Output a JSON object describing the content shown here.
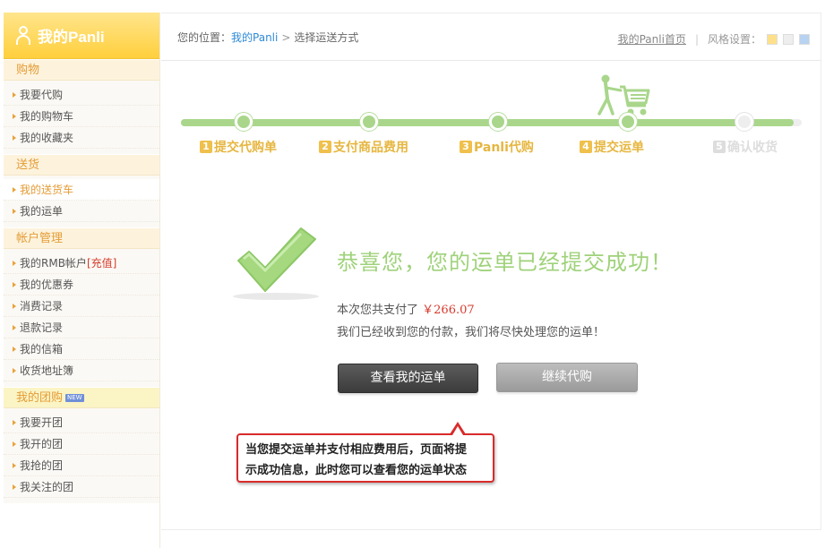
{
  "sidebar": {
    "brand": "我的Panli",
    "sections": [
      {
        "title": "购物",
        "items": [
          {
            "label": "我要代购"
          },
          {
            "label": "我的购物车"
          },
          {
            "label": "我的收藏夹"
          }
        ]
      },
      {
        "title": "送货",
        "items": [
          {
            "label": "我的送货车"
          },
          {
            "label": "我的运单"
          }
        ]
      },
      {
        "title": "帐户管理",
        "items": [
          {
            "label": "我的RMB帐户",
            "tag": "[充值]"
          },
          {
            "label": "我的优惠券"
          },
          {
            "label": "消费记录"
          },
          {
            "label": "退款记录"
          },
          {
            "label": "我的信箱"
          },
          {
            "label": "收货地址簿"
          }
        ]
      },
      {
        "title": "我的团购",
        "badge": "NEW",
        "items": [
          {
            "label": "我要开团"
          },
          {
            "label": "我开的团"
          },
          {
            "label": "我抢的团"
          },
          {
            "label": "我关注的团"
          }
        ]
      }
    ],
    "active_item": "我的送货车"
  },
  "header": {
    "breadcrumb_prefix": "您的位置：",
    "breadcrumb_link": "我的Panli",
    "breadcrumb_sep": ">",
    "breadcrumb_current": "选择运送方式",
    "home_link": "我的Panli首页",
    "divider": "|",
    "style_label": "风格设置：",
    "style_swatches": [
      "#ffe08a",
      "#eeeeee",
      "#b8d2f2"
    ]
  },
  "progress": {
    "steps": [
      {
        "num": "1",
        "label": "提交代购单",
        "done": true
      },
      {
        "num": "2",
        "label": "支付商品费用",
        "done": true
      },
      {
        "num": "3",
        "label": "Panli代购",
        "done": true
      },
      {
        "num": "4",
        "label": "提交运单",
        "done": true
      },
      {
        "num": "5",
        "label": "确认收货",
        "done": false
      }
    ],
    "current_step": 4,
    "accent_color": "#a9d68b"
  },
  "result": {
    "title": "恭喜您，您的运单已经提交成功！",
    "paid_text": "本次您共支付了",
    "amount": "￥266.07",
    "received_text": "我们已经收到您的付款，我们将尽快处理您的运单！"
  },
  "buttons": {
    "view_waybill": "查看我的运单",
    "continue_shopping": "继续代购"
  },
  "callout": {
    "line1": "当您提交运单并支付相应费用后，页面将提",
    "line2": "示成功信息，此时您可以查看您的运单状态"
  }
}
